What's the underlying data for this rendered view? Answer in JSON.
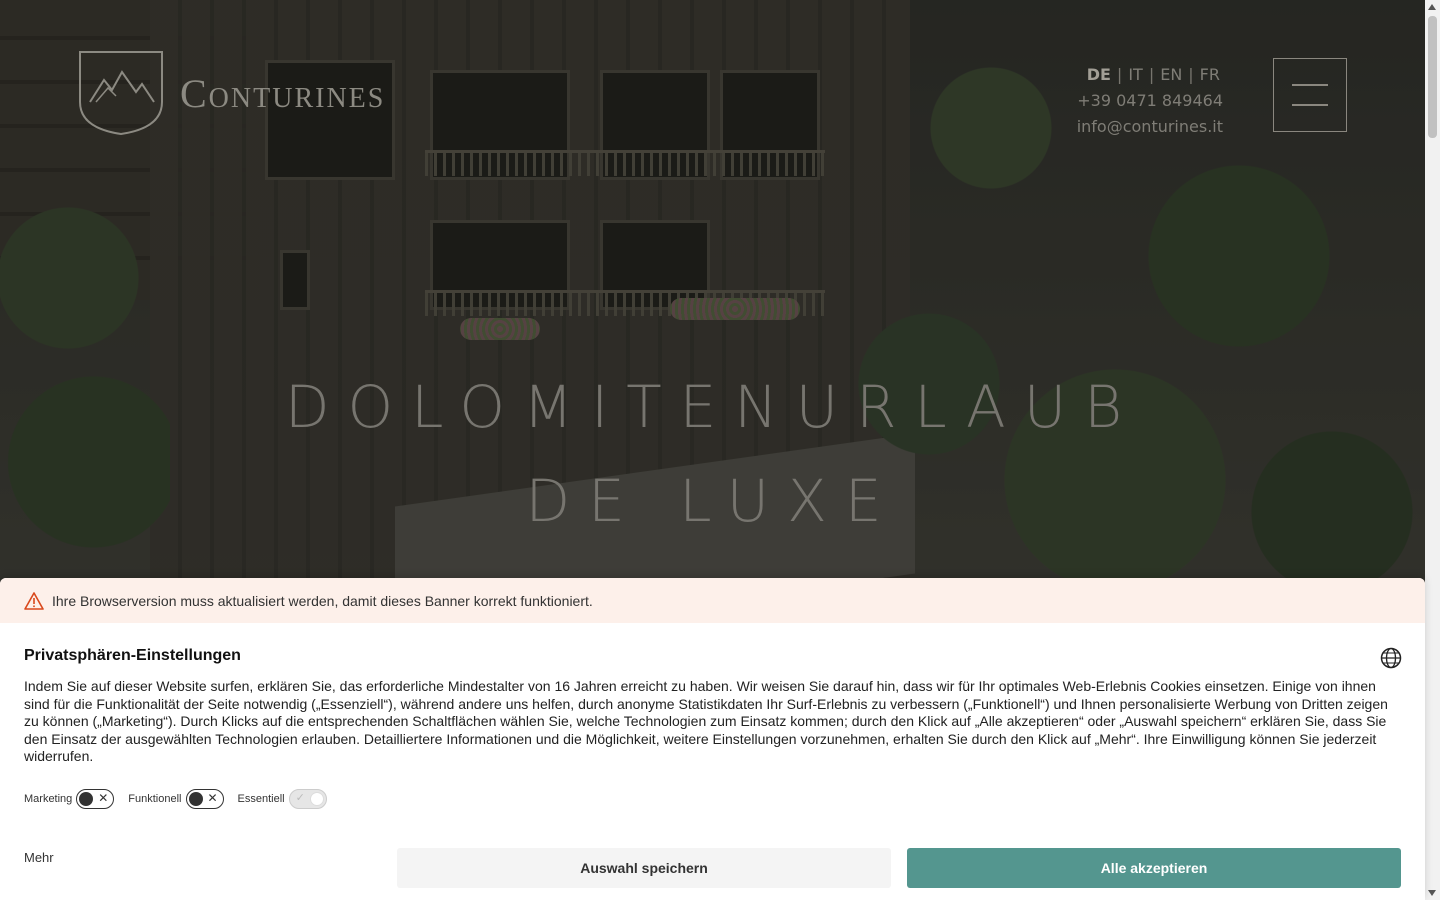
{
  "header": {
    "logo_text": "Conturines",
    "languages": [
      {
        "code": "DE",
        "active": true
      },
      {
        "code": "IT",
        "active": false
      },
      {
        "code": "EN",
        "active": false
      },
      {
        "code": "FR",
        "active": false
      }
    ],
    "phone": "+39 0471 849464",
    "email": "info@conturines.it",
    "menu_icon": "hamburger-icon"
  },
  "hero": {
    "headline_line1": "DOLOMITENURLAUB",
    "headline_line2": "DE LUXE"
  },
  "consent": {
    "warning_text": "Ihre Browserversion muss aktualisiert werden, damit dieses Banner korrekt funktioniert.",
    "title": "Privatsphären-Einstellungen",
    "body": "Indem Sie auf dieser Website surfen, erklären Sie, das erforderliche Mindestalter von 16 Jahren erreicht zu haben. Wir weisen Sie darauf hin, dass wir für Ihr optimales Web-Erlebnis Cookies einsetzen. Einige von ihnen sind für die Funktionalität der Seite notwendig („Essenziell“), während andere uns helfen, durch anonyme Statistikdaten Ihr Surf-Erlebnis zu verbessern („Funktionell“) und Ihnen personalisierte Werbung von Dritten zeigen zu können („Marketing“). Durch Klicks auf die entsprechenden Schaltflächen wählen Sie, welche Technologien zum Einsatz kommen; durch den Klick auf „Alle akzeptieren“ oder „Auswahl speichern“ erklären Sie, dass Sie den Einsatz der ausgewählten Technologien erlauben. Detailliertere Informationen und die Möglichkeit, weitere Einstellungen vorzunehmen, erhalten Sie durch den Klick auf „Mehr“. Ihre Einwilligung können Sie jederzeit widerrufen.",
    "toggles": [
      {
        "label": "Marketing",
        "enabled": false
      },
      {
        "label": "Funktionell",
        "enabled": false
      },
      {
        "label": "Essentiell",
        "enabled": true
      }
    ],
    "more_label": "Mehr",
    "save_label": "Auswahl speichern",
    "accept_label": "Alle akzeptieren",
    "accent_color": "#54968f",
    "warning_bg": "#fdf0ea"
  }
}
